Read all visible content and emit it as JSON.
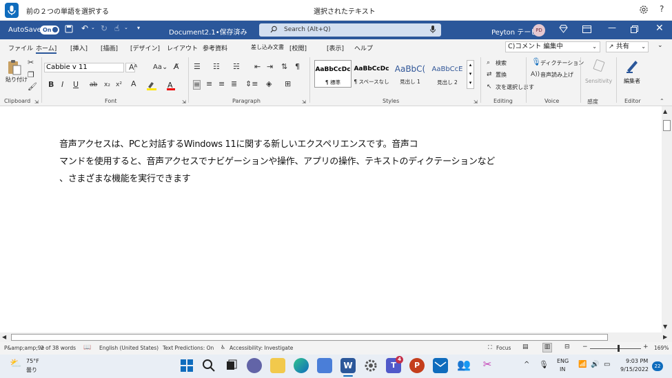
{
  "voice_bar": {
    "command": "前の２つの単語を選択する",
    "status": "選択されたテキスト",
    "help": "?"
  },
  "title_bar": {
    "autosave_label": "AutoSave",
    "autosave_state": "On",
    "document_title": "Document2.1•保存済み",
    "search_placeholder": "Search (Alt+Q)",
    "user_name": "Peyton テービス",
    "user_initials": "PD"
  },
  "menu": {
    "tabs": [
      "ファイル",
      "ホーム]",
      "[挿入]",
      "[描画]",
      "[デザイン]",
      "レイアウト",
      "参考資料",
      "差し込み文書",
      "[校閲]",
      "[表示]",
      "ヘルプ"
    ],
    "comment_label": "C)コメント 編集中",
    "share_label": "共有"
  },
  "ribbon": {
    "paste_label": "貼り付け",
    "font_name": "Cabbie v 11",
    "group_clipboard": "Clipboard",
    "group_font": "Font",
    "group_paragraph": "Paragraph",
    "group_styles": "Styles",
    "group_editing": "Editing",
    "group_voice": "Voice",
    "group_sensitivity": "感度",
    "group_editor": "Editor",
    "styles": [
      {
        "preview": "AaBbCcDc",
        "name": "¶ 標準"
      },
      {
        "preview": "AaBbCcDc",
        "name": "¶ スペースなし"
      },
      {
        "preview": "AaBbC(",
        "name": "見出し 1"
      },
      {
        "preview": "AaBbCcE",
        "name": "見出し 2"
      }
    ],
    "find_label": "検索",
    "replace_label": "置換",
    "select_label": "次を選択します",
    "dictate_label": "ディクテーション",
    "read_aloud_label": "音声読み上げ",
    "sensitivity_label": "Sensitivity",
    "editor_label": "編集者"
  },
  "document": {
    "line1": "音声アクセスは、PCと対話するWindows 11に関する新しいエクスペリエンスです。音声コ",
    "line2": "マンドを使用すると、音声アクセスでナビゲーションや操作、アプリの操作、テキストのディクテーションなど",
    "line3": "、さまざまな機能を実行できます"
  },
  "status_bar": {
    "page": "P&amp;amp;9e",
    "words": "2 of 38 words",
    "language": "English (United States)",
    "predictions": "Text Predictions: On",
    "accessibility": "Accessibility: Investigate",
    "focus": "Focus",
    "zoom": "169%"
  },
  "taskbar": {
    "weather_temp": "75°F",
    "weather_desc": "曇り",
    "lang_top": "ENG",
    "lang_bottom": "IN",
    "time": "9:03 PM",
    "date": "9/15/2022",
    "notif_count": "22",
    "teams_badge": "4"
  }
}
